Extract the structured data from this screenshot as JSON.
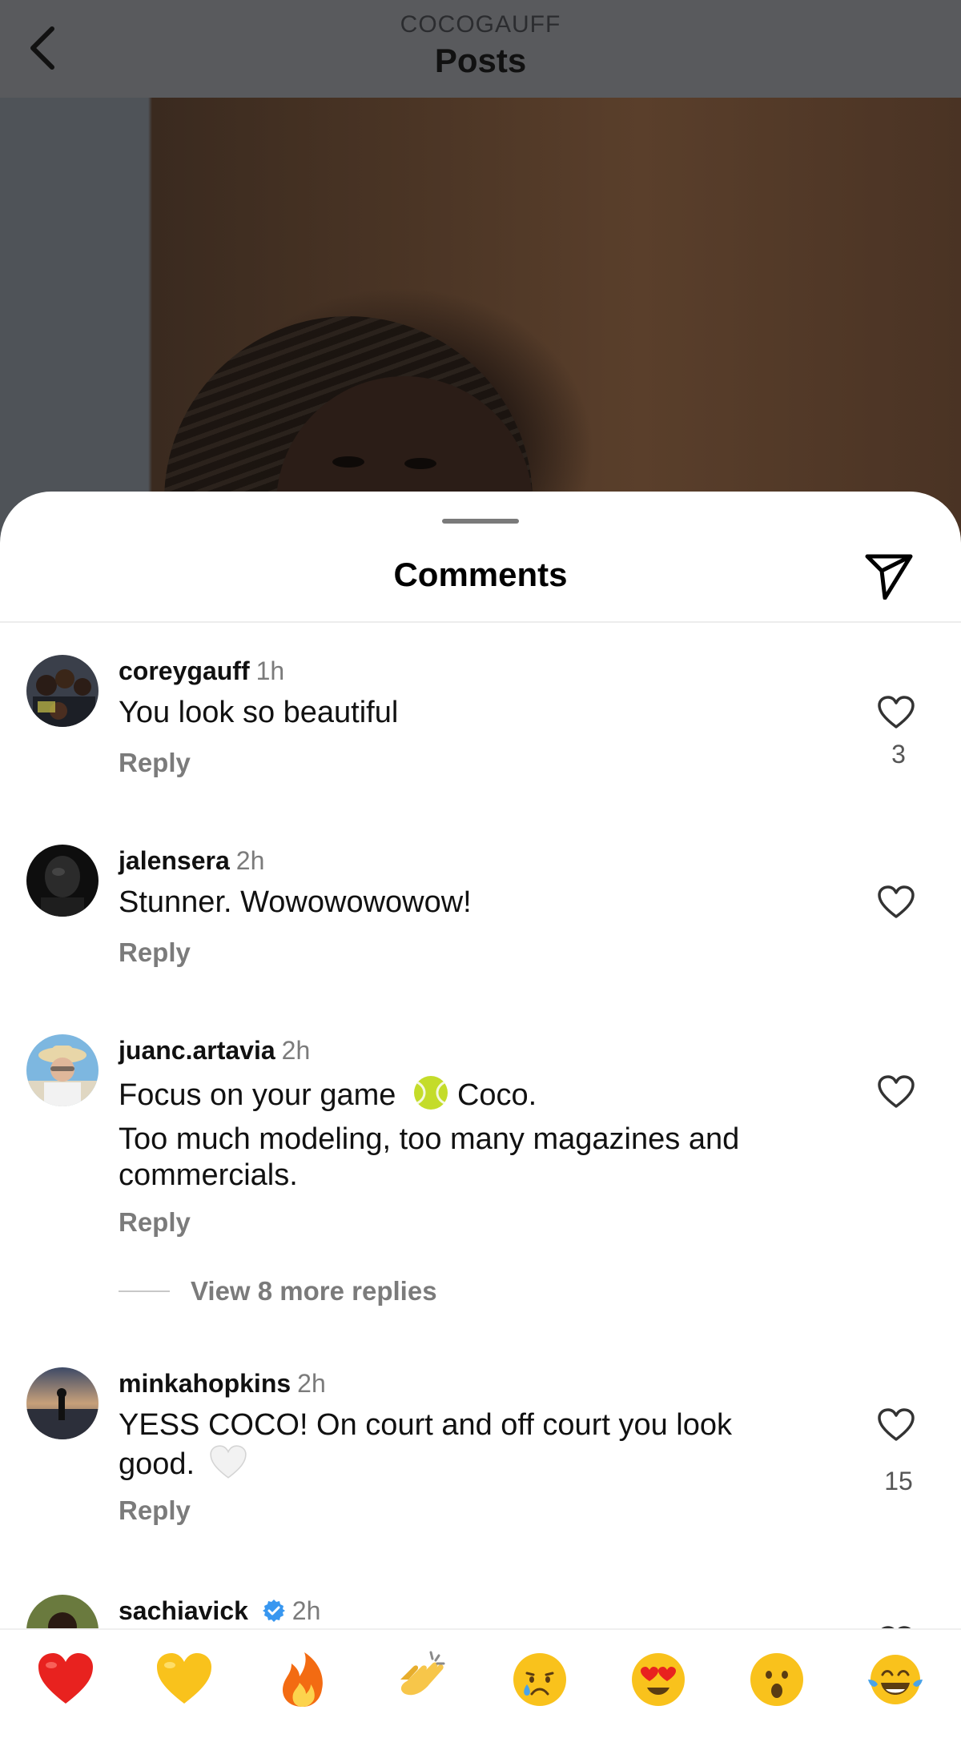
{
  "header": {
    "subtitle": "COCOGAUFF",
    "title": "Posts",
    "back_icon": "chevron-left-icon"
  },
  "sheet": {
    "title": "Comments",
    "share_icon": "paper-plane-icon"
  },
  "comments": [
    {
      "username": "coreygauff",
      "time": "1h",
      "verified": false,
      "lines": [
        "You look so beautiful"
      ],
      "reply_label": "Reply",
      "likes": "3"
    },
    {
      "username": "jalensera",
      "time": "2h",
      "verified": false,
      "lines": [
        "Stunner. Wowowowowow!"
      ],
      "reply_label": "Reply",
      "likes": ""
    },
    {
      "username": "juanc.artavia",
      "time": "2h",
      "verified": false,
      "lines": [
        "Focus on your game",
        "Coco.",
        "Too much modeling, too many magazines and commercials."
      ],
      "inline_emoji": "tennis-ball-icon",
      "reply_label": "Reply",
      "likes": "",
      "more_replies": "View 8 more replies"
    },
    {
      "username": "minkahopkins",
      "time": "2h",
      "verified": false,
      "lines": [
        "YESS COCO! On court and off court you look good."
      ],
      "inline_emoji": "white-heart-icon",
      "reply_label": "Reply",
      "likes": "15"
    },
    {
      "username": "sachiavick",
      "time": "2h",
      "verified": true,
      "lines": [],
      "reply_label": "",
      "likes": ""
    }
  ],
  "emoji_bar": [
    "red-heart-emoji",
    "yellow-heart-emoji",
    "fire-emoji",
    "clapping-hands-emoji",
    "crying-face-emoji",
    "heart-eyes-emoji",
    "surprised-face-emoji",
    "tears-of-joy-emoji"
  ],
  "colors": {
    "text_primary": "#111111",
    "text_secondary": "#7b7b7b",
    "verified_blue": "#3897f0",
    "header_overlay": "#595a5d"
  }
}
